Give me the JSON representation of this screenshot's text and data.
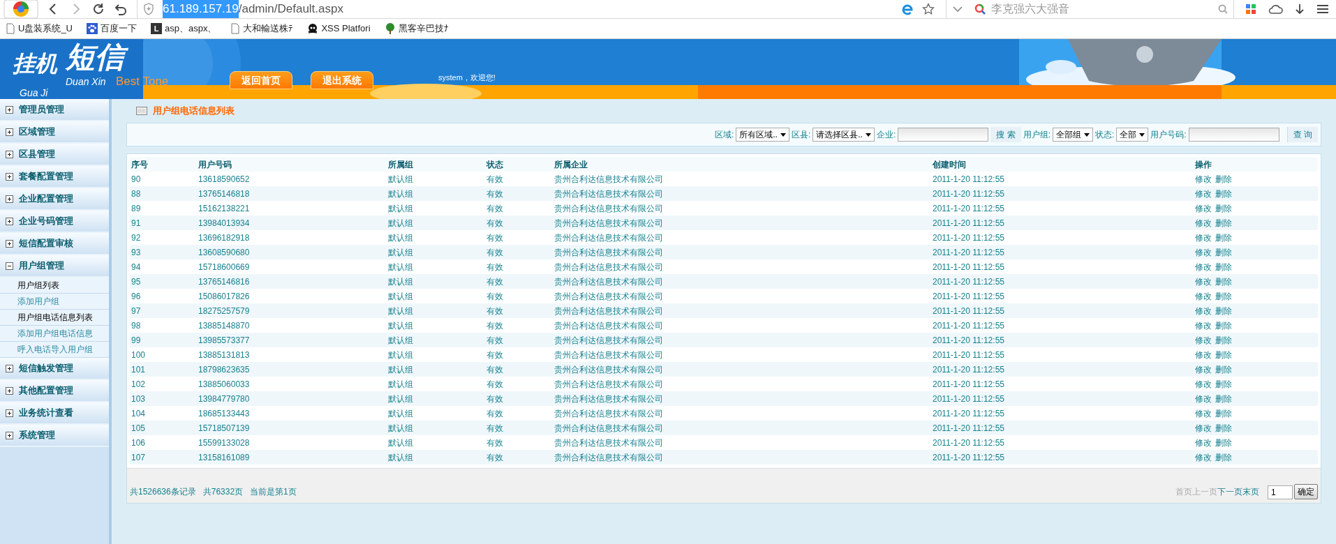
{
  "browser": {
    "address_selected": "61.189.157.19",
    "address_rest": "/admin/Default.aspx",
    "search_placeholder": "李克强六大强音",
    "bookmarks": [
      {
        "label": "U盘装系统_U",
        "kind": "page"
      },
      {
        "label": "百度一下",
        "kind": "paw"
      },
      {
        "label": "asp、aspx、",
        "kind": "letter",
        "icon_letter": "L"
      },
      {
        "label": "大和輸送株ﾃ",
        "kind": "page"
      },
      {
        "label": "XSS Platfori",
        "kind": "skull"
      },
      {
        "label": "黑客辛巴技ﾅ",
        "kind": "tree"
      }
    ]
  },
  "header": {
    "logo_main": "挂机",
    "logo_sub": "短信",
    "logo_pinyin_1": "Duan Xin",
    "logo_pinyin_2": "Gua Ji",
    "brand": "Best Tone",
    "tabs": [
      {
        "label": "返回首页"
      },
      {
        "label": "退出系统"
      }
    ],
    "welcome": "system，欢迎您!"
  },
  "sidebar": {
    "groups": [
      {
        "label": "管理员管理",
        "expanded": false
      },
      {
        "label": "区域管理",
        "expanded": false
      },
      {
        "label": "区县管理",
        "expanded": false
      },
      {
        "label": "套餐配置管理",
        "expanded": false
      },
      {
        "label": "企业配置管理",
        "expanded": false
      },
      {
        "label": "企业号码管理",
        "expanded": false
      },
      {
        "label": "短信配置审核",
        "expanded": false
      },
      {
        "label": "用户组管理",
        "expanded": true,
        "children": [
          {
            "label": "用户组列表",
            "visited": true
          },
          {
            "label": "添加用户组",
            "visited": false
          },
          {
            "label": "用户组电话信息列表",
            "visited": true
          },
          {
            "label": "添加用户组电话信息",
            "visited": false
          },
          {
            "label": "呼入电话导入用户组",
            "visited": false
          }
        ]
      },
      {
        "label": "短信触发管理",
        "expanded": false
      },
      {
        "label": "其他配置管理",
        "expanded": false
      },
      {
        "label": "业务统计查看",
        "expanded": false
      },
      {
        "label": "系统管理",
        "expanded": false
      }
    ]
  },
  "page_title": "用户组电话信息列表",
  "filters": [
    {
      "kind": "select",
      "label": "区域:",
      "value": "所有区域.."
    },
    {
      "kind": "select",
      "label": "区县:",
      "value": "请选择区县.."
    },
    {
      "kind": "input",
      "label": "企业:"
    },
    {
      "kind": "button",
      "label": "搜 索"
    },
    {
      "kind": "select",
      "label": "用户组:",
      "value": "全部组"
    },
    {
      "kind": "select",
      "label": "状态:",
      "value": "全部"
    },
    {
      "kind": "input",
      "label": "用户号码:"
    },
    {
      "kind": "button",
      "label": "查 询"
    }
  ],
  "table": {
    "columns": [
      "序号",
      "用户号码",
      "所属组",
      "状态",
      "所属企业",
      "创建时间",
      "操作"
    ],
    "rows": [
      {
        "cells": [
          "90",
          "13618590652",
          "默认组",
          "有效",
          "贵州合利达信息技术有限公司",
          "2011-1-20 11:12:55"
        ],
        "actions": [
          "修改",
          "删除"
        ]
      },
      {
        "cells": [
          "88",
          "13765146818",
          "默认组",
          "有效",
          "贵州合利达信息技术有限公司",
          "2011-1-20 11:12:55"
        ],
        "actions": [
          "修改",
          "删除"
        ]
      },
      {
        "cells": [
          "89",
          "15162138221",
          "默认组",
          "有效",
          "贵州合利达信息技术有限公司",
          "2011-1-20 11:12:55"
        ],
        "actions": [
          "修改",
          "删除"
        ]
      },
      {
        "cells": [
          "91",
          "13984013934",
          "默认组",
          "有效",
          "贵州合利达信息技术有限公司",
          "2011-1-20 11:12:55"
        ],
        "actions": [
          "修改",
          "删除"
        ]
      },
      {
        "cells": [
          "92",
          "13696182918",
          "默认组",
          "有效",
          "贵州合利达信息技术有限公司",
          "2011-1-20 11:12:55"
        ],
        "actions": [
          "修改",
          "删除"
        ]
      },
      {
        "cells": [
          "93",
          "13608590680",
          "默认组",
          "有效",
          "贵州合利达信息技术有限公司",
          "2011-1-20 11:12:55"
        ],
        "actions": [
          "修改",
          "删除"
        ]
      },
      {
        "cells": [
          "94",
          "15718600669",
          "默认组",
          "有效",
          "贵州合利达信息技术有限公司",
          "2011-1-20 11:12:55"
        ],
        "actions": [
          "修改",
          "删除"
        ]
      },
      {
        "cells": [
          "95",
          "13765146816",
          "默认组",
          "有效",
          "贵州合利达信息技术有限公司",
          "2011-1-20 11:12:55"
        ],
        "actions": [
          "修改",
          "删除"
        ]
      },
      {
        "cells": [
          "96",
          "15086017826",
          "默认组",
          "有效",
          "贵州合利达信息技术有限公司",
          "2011-1-20 11:12:55"
        ],
        "actions": [
          "修改",
          "删除"
        ]
      },
      {
        "cells": [
          "97",
          "18275257579",
          "默认组",
          "有效",
          "贵州合利达信息技术有限公司",
          "2011-1-20 11:12:55"
        ],
        "actions": [
          "修改",
          "删除"
        ]
      },
      {
        "cells": [
          "98",
          "13885148870",
          "默认组",
          "有效",
          "贵州合利达信息技术有限公司",
          "2011-1-20 11:12:55"
        ],
        "actions": [
          "修改",
          "删除"
        ]
      },
      {
        "cells": [
          "99",
          "13985573377",
          "默认组",
          "有效",
          "贵州合利达信息技术有限公司",
          "2011-1-20 11:12:55"
        ],
        "actions": [
          "修改",
          "删除"
        ]
      },
      {
        "cells": [
          "100",
          "13885131813",
          "默认组",
          "有效",
          "贵州合利达信息技术有限公司",
          "2011-1-20 11:12:55"
        ],
        "actions": [
          "修改",
          "删除"
        ]
      },
      {
        "cells": [
          "101",
          "18798623635",
          "默认组",
          "有效",
          "贵州合利达信息技术有限公司",
          "2011-1-20 11:12:55"
        ],
        "actions": [
          "修改",
          "删除"
        ]
      },
      {
        "cells": [
          "102",
          "13885060033",
          "默认组",
          "有效",
          "贵州合利达信息技术有限公司",
          "2011-1-20 11:12:55"
        ],
        "actions": [
          "修改",
          "删除"
        ]
      },
      {
        "cells": [
          "103",
          "13984779780",
          "默认组",
          "有效",
          "贵州合利达信息技术有限公司",
          "2011-1-20 11:12:55"
        ],
        "actions": [
          "修改",
          "删除"
        ]
      },
      {
        "cells": [
          "104",
          "18685133443",
          "默认组",
          "有效",
          "贵州合利达信息技术有限公司",
          "2011-1-20 11:12:55"
        ],
        "actions": [
          "修改",
          "删除"
        ]
      },
      {
        "cells": [
          "105",
          "15718507139",
          "默认组",
          "有效",
          "贵州合利达信息技术有限公司",
          "2011-1-20 11:12:55"
        ],
        "actions": [
          "修改",
          "删除"
        ]
      },
      {
        "cells": [
          "106",
          "15599133028",
          "默认组",
          "有效",
          "贵州合利达信息技术有限公司",
          "2011-1-20 11:12:55"
        ],
        "actions": [
          "修改",
          "删除"
        ]
      },
      {
        "cells": [
          "107",
          "13158161089",
          "默认组",
          "有效",
          "贵州合利达信息技术有限公司",
          "2011-1-20 11:12:55"
        ],
        "actions": [
          "修改",
          "删除"
        ]
      }
    ]
  },
  "footer": {
    "summary": [
      "共1526636条记录",
      "共76332页",
      "当前是第1页"
    ],
    "pager": [
      {
        "label": "首页",
        "disabled": true
      },
      {
        "label": "上一页",
        "disabled": true
      },
      {
        "label": "下一页",
        "disabled": false
      },
      {
        "label": "末页",
        "disabled": false
      }
    ],
    "page_value": "1",
    "go_button": "确定"
  }
}
